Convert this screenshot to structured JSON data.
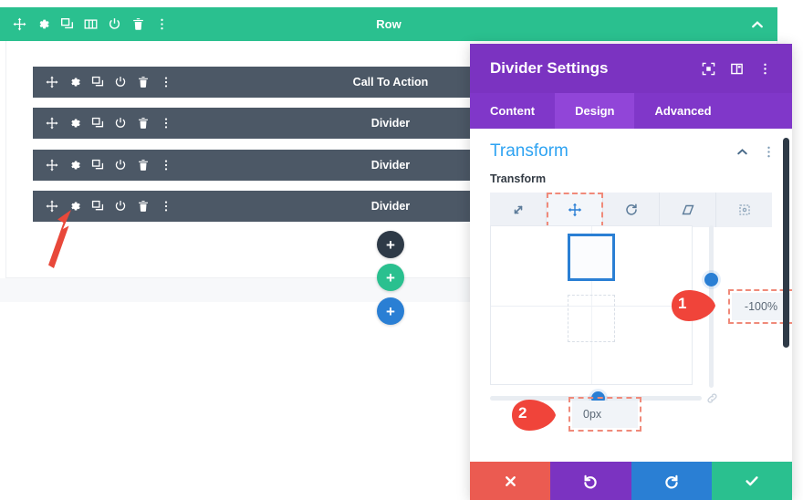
{
  "builder": {
    "row": {
      "label": "Row",
      "accent_color": "#2ac08f",
      "tools": [
        {
          "name": "move-icon",
          "title": "Move"
        },
        {
          "name": "gear-icon",
          "title": "Settings"
        },
        {
          "name": "duplicate-icon",
          "title": "Duplicate"
        },
        {
          "name": "columns-icon",
          "title": "Change Column Structure"
        },
        {
          "name": "disable-icon",
          "title": "Disable"
        },
        {
          "name": "trash-icon",
          "title": "Delete"
        },
        {
          "name": "more-icon",
          "title": "More Options"
        }
      ],
      "collapse_icon": "chevron-up-icon"
    },
    "modules": [
      {
        "label": "Call To Action",
        "tools": [
          "move-icon",
          "gear-icon",
          "duplicate-icon",
          "disable-icon",
          "trash-icon",
          "more-icon"
        ]
      },
      {
        "label": "Divider",
        "tools": [
          "move-icon",
          "gear-icon",
          "duplicate-icon",
          "disable-icon",
          "trash-icon",
          "more-icon"
        ]
      },
      {
        "label": "Divider",
        "tools": [
          "move-icon",
          "gear-icon",
          "duplicate-icon",
          "disable-icon",
          "trash-icon",
          "more-icon"
        ]
      },
      {
        "label": "Divider",
        "tools": [
          "move-icon",
          "gear-icon",
          "duplicate-icon",
          "disable-icon",
          "trash-icon",
          "more-icon"
        ]
      }
    ],
    "module_bar_color": "#4c5866",
    "add_buttons": [
      {
        "name": "add-module-button",
        "label": "+",
        "color": "#2e3a47"
      },
      {
        "name": "add-row-button",
        "label": "+",
        "color": "#2ac08f"
      },
      {
        "name": "add-section-button",
        "label": "+",
        "color": "#2a7fd4"
      }
    ],
    "annotation_arrow": {
      "name": "red-arrow-annotation",
      "color": "#e8483a",
      "points_to": "gear-icon"
    }
  },
  "panel": {
    "title": "Divider Settings",
    "header_color": "#7b33c1",
    "header_icons": [
      {
        "name": "focus-mode-icon",
        "title": "Focus Mode"
      },
      {
        "name": "panel-layout-icon",
        "title": "Panel Layout"
      },
      {
        "name": "panel-more-icon",
        "title": "More"
      }
    ],
    "tabs": [
      {
        "label": "Content",
        "active": false
      },
      {
        "label": "Design",
        "active": true
      },
      {
        "label": "Advanced",
        "active": false
      }
    ],
    "section": {
      "title": "Transform",
      "accent_color": "#2ea3f2",
      "collapse_icon": "chevron-up-icon",
      "more_icon": "section-more-icon"
    },
    "transform": {
      "field_label": "Transform",
      "modes": [
        {
          "name": "scale-icon",
          "label": "Scale",
          "selected": false
        },
        {
          "name": "translate-icon",
          "label": "Translate",
          "selected": true
        },
        {
          "name": "rotate-icon",
          "label": "Rotate",
          "selected": false
        },
        {
          "name": "skew-icon",
          "label": "Skew",
          "selected": false
        },
        {
          "name": "origin-icon",
          "label": "Transform Origin",
          "selected": false
        }
      ],
      "vertical_value": "-100%",
      "horizontal_value": "0px",
      "handle_color": "#2a7fd4",
      "link_icon": "link-icon"
    },
    "callouts": [
      {
        "number": "1",
        "label": "-100%",
        "color": "#f0443a"
      },
      {
        "number": "2",
        "label": "0px",
        "color": "#f0443a"
      }
    ],
    "footer": [
      {
        "name": "cancel-button",
        "icon": "close-icon",
        "color": "#eb5b51"
      },
      {
        "name": "undo-button",
        "icon": "undo-icon",
        "color": "#7b33c1"
      },
      {
        "name": "redo-button",
        "icon": "redo-icon",
        "color": "#2a7fd4"
      },
      {
        "name": "save-button",
        "icon": "check-icon",
        "color": "#2ac08f"
      }
    ]
  }
}
